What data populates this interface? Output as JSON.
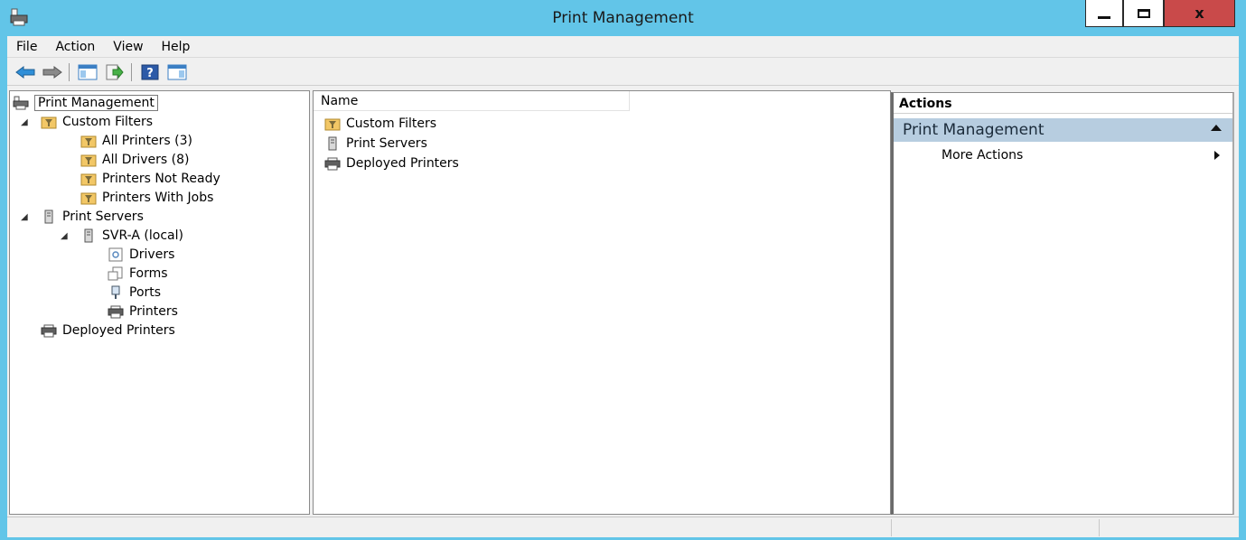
{
  "window": {
    "title": "Print Management",
    "controls": {
      "minimize": "minimize",
      "maximize": "maximize",
      "close": "x"
    }
  },
  "menu": [
    "File",
    "Action",
    "View",
    "Help"
  ],
  "toolbar": [
    "back-arrow-icon",
    "forward-arrow-icon",
    "show-hide-console-tree-icon",
    "export-list-icon",
    "help-icon",
    "show-hide-action-pane-icon"
  ],
  "tree": {
    "root": "Print Management",
    "custom_filters": "Custom Filters",
    "all_printers": "All Printers (3)",
    "all_drivers": "All Drivers (8)",
    "printers_not_ready": "Printers Not Ready",
    "printers_with_jobs": "Printers With Jobs",
    "print_servers": "Print Servers",
    "server": "SVR-A (local)",
    "drivers": "Drivers",
    "forms": "Forms",
    "ports": "Ports",
    "printers": "Printers",
    "deployed_printers": "Deployed Printers"
  },
  "list": {
    "column_name": "Name",
    "items": [
      "Custom Filters",
      "Print Servers",
      "Deployed Printers"
    ]
  },
  "actions": {
    "title": "Actions",
    "section": "Print Management",
    "more_actions": "More Actions"
  },
  "colors": {
    "titlebar": "#62c5e8",
    "close_button": "#c94a4a",
    "section_header": "#b7cde0"
  }
}
